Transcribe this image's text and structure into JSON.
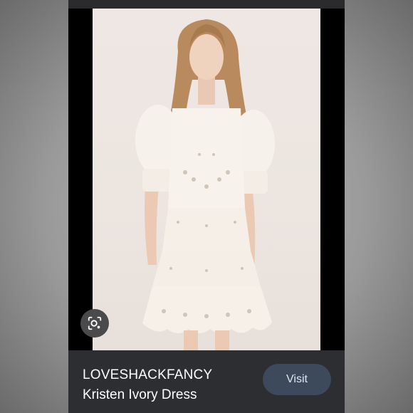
{
  "result": {
    "brand": "LOVESHACKFANCY",
    "title": "Kristen Ivory Dress",
    "visit_label": "Visit",
    "lens_icon": "lens-search-icon"
  },
  "colors": {
    "card_background": "#1c1c1e",
    "info_bar": "#2d2e31",
    "visit_button": "#3c4a5c"
  }
}
